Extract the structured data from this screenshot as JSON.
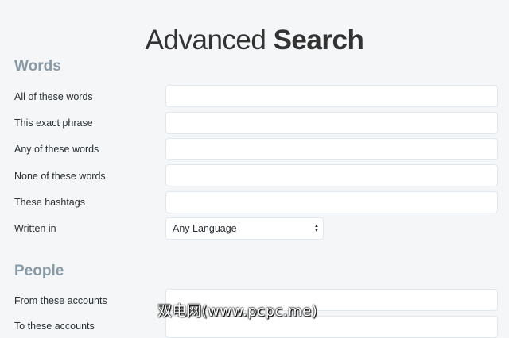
{
  "header": {
    "title_light": "Advanced",
    "title_bold": "Search"
  },
  "words": {
    "heading": "Words",
    "fields": [
      {
        "label": "All of these words",
        "value": ""
      },
      {
        "label": "This exact phrase",
        "value": ""
      },
      {
        "label": "Any of these words",
        "value": ""
      },
      {
        "label": "None of these words",
        "value": ""
      },
      {
        "label": "These hashtags",
        "value": ""
      }
    ],
    "language": {
      "label": "Written in",
      "selected": "Any Language"
    }
  },
  "people": {
    "heading": "People",
    "fields": [
      {
        "label": "From these accounts",
        "value": ""
      },
      {
        "label": "To these accounts",
        "value": ""
      }
    ]
  },
  "watermark": "双电网(www.pcpc.me)",
  "colors": {
    "background": "#f5f6f7",
    "section_heading": "#8899a6",
    "field_border": "#e1e8ed"
  }
}
